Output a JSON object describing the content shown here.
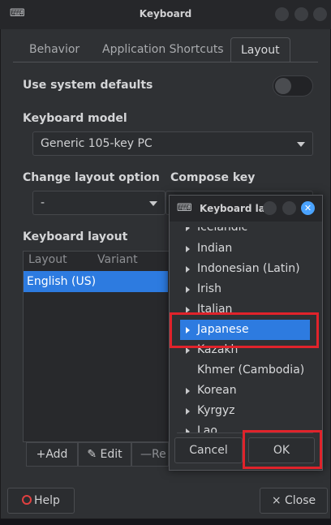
{
  "window": {
    "title": "Keyboard",
    "icon": "keyboard-icon"
  },
  "tabs": [
    {
      "label": "Behavior"
    },
    {
      "label": "Application Shortcuts"
    },
    {
      "label": "Layout",
      "active": true
    }
  ],
  "layout_tab": {
    "use_system_defaults_label": "Use system defaults",
    "use_system_defaults_value": false,
    "keyboard_model_label": "Keyboard model",
    "keyboard_model_value": "Generic 105-key PC",
    "change_layout_option_label": "Change layout option",
    "change_layout_option_value": "-",
    "compose_key_label": "Compose key",
    "keyboard_layout_label": "Keyboard layout",
    "table_headers": [
      "Layout",
      "Variant"
    ],
    "table_rows": [
      {
        "layout": "English (US)",
        "variant": ""
      }
    ],
    "toolbar": {
      "add": "Add",
      "edit": "Edit",
      "remove": "Re"
    }
  },
  "footer": {
    "help": "Help",
    "close": "Close"
  },
  "dialog": {
    "title": "Keyboard lay",
    "items": [
      {
        "label": "Icelandic",
        "expandable": true
      },
      {
        "label": "Indian",
        "expandable": true
      },
      {
        "label": "Indonesian (Latin)",
        "expandable": true
      },
      {
        "label": "Irish",
        "expandable": true
      },
      {
        "label": "Italian",
        "expandable": true
      },
      {
        "label": "Japanese",
        "expandable": true,
        "selected": true
      },
      {
        "label": "Kazakh",
        "expandable": true
      },
      {
        "label": "Khmer (Cambodia)",
        "expandable": false
      },
      {
        "label": "Korean",
        "expandable": true
      },
      {
        "label": "Kyrgyz",
        "expandable": true
      },
      {
        "label": "Lao",
        "expandable": true
      }
    ],
    "cancel": "Cancel",
    "ok": "OK"
  },
  "colors": {
    "accent": "#2d7be0",
    "highlight": "#e0232b",
    "window_bg": "#2f3134"
  }
}
